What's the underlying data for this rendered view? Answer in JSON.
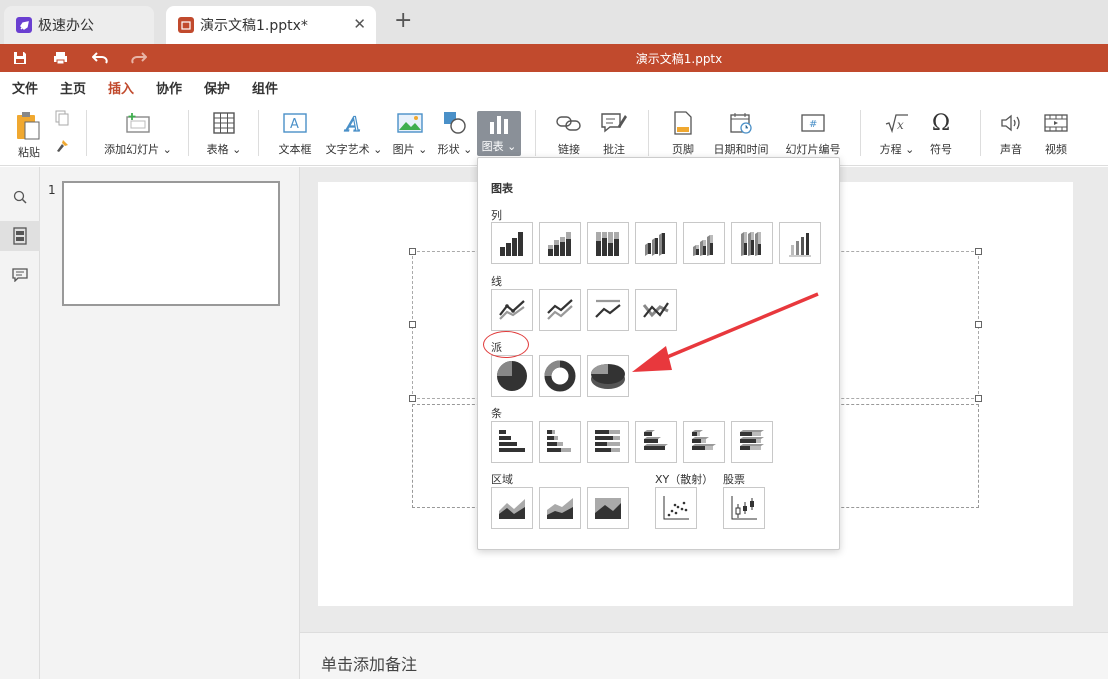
{
  "tabs": [
    {
      "label": "极速办公"
    },
    {
      "label": "演示文稿1.pptx*"
    }
  ],
  "title_bar": {
    "doc_title": "演示文稿1.pptx"
  },
  "menu": [
    "文件",
    "主页",
    "插入",
    "协作",
    "保护",
    "组件"
  ],
  "ribbon": {
    "paste": "粘贴",
    "add_slide": "添加幻灯片",
    "table": "表格",
    "textbox": "文本框",
    "wordart": "文字艺术",
    "image": "图片",
    "shape": "形状",
    "chart": "图表",
    "link": "链接",
    "comment": "批注",
    "footer": "页脚",
    "datetime": "日期和时间",
    "slide_number": "幻灯片编号",
    "equation": "方程",
    "symbol": "符号",
    "audio": "声音",
    "video": "视频"
  },
  "slide_panel": {
    "number": "1"
  },
  "notes": {
    "placeholder": "单击添加备注"
  },
  "chart_menu": {
    "title": "图表",
    "sections": {
      "column": "列",
      "line": "线",
      "pie": "派",
      "bar": "条",
      "area": "区域",
      "xy": "XY（散射）",
      "stock": "股票"
    }
  },
  "colors": {
    "accent": "#c14a2d",
    "arrow": "#e8383d"
  }
}
